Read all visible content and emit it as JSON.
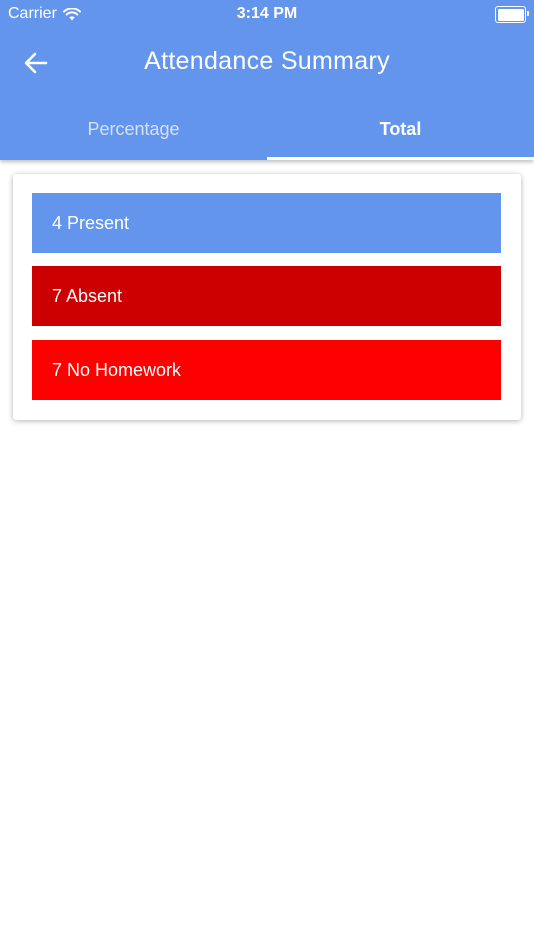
{
  "status_bar": {
    "carrier": "Carrier",
    "time": "3:14 PM",
    "icons": [
      "wifi-icon",
      "battery-icon"
    ]
  },
  "header": {
    "title": "Attendance Summary",
    "back_icon": "arrow-left-icon"
  },
  "tabs": [
    {
      "label": "Percentage",
      "active": false
    },
    {
      "label": "Total",
      "active": true
    }
  ],
  "summary": {
    "items": [
      {
        "label": "4 Present",
        "color": "#6495ED"
      },
      {
        "label": "7 Absent",
        "color": "#CC0000"
      },
      {
        "label": "7 No Homework",
        "color": "#FF0000"
      }
    ]
  },
  "colors": {
    "primary": "#6495ED",
    "absent": "#CC0000",
    "no_homework": "#FF0000"
  }
}
